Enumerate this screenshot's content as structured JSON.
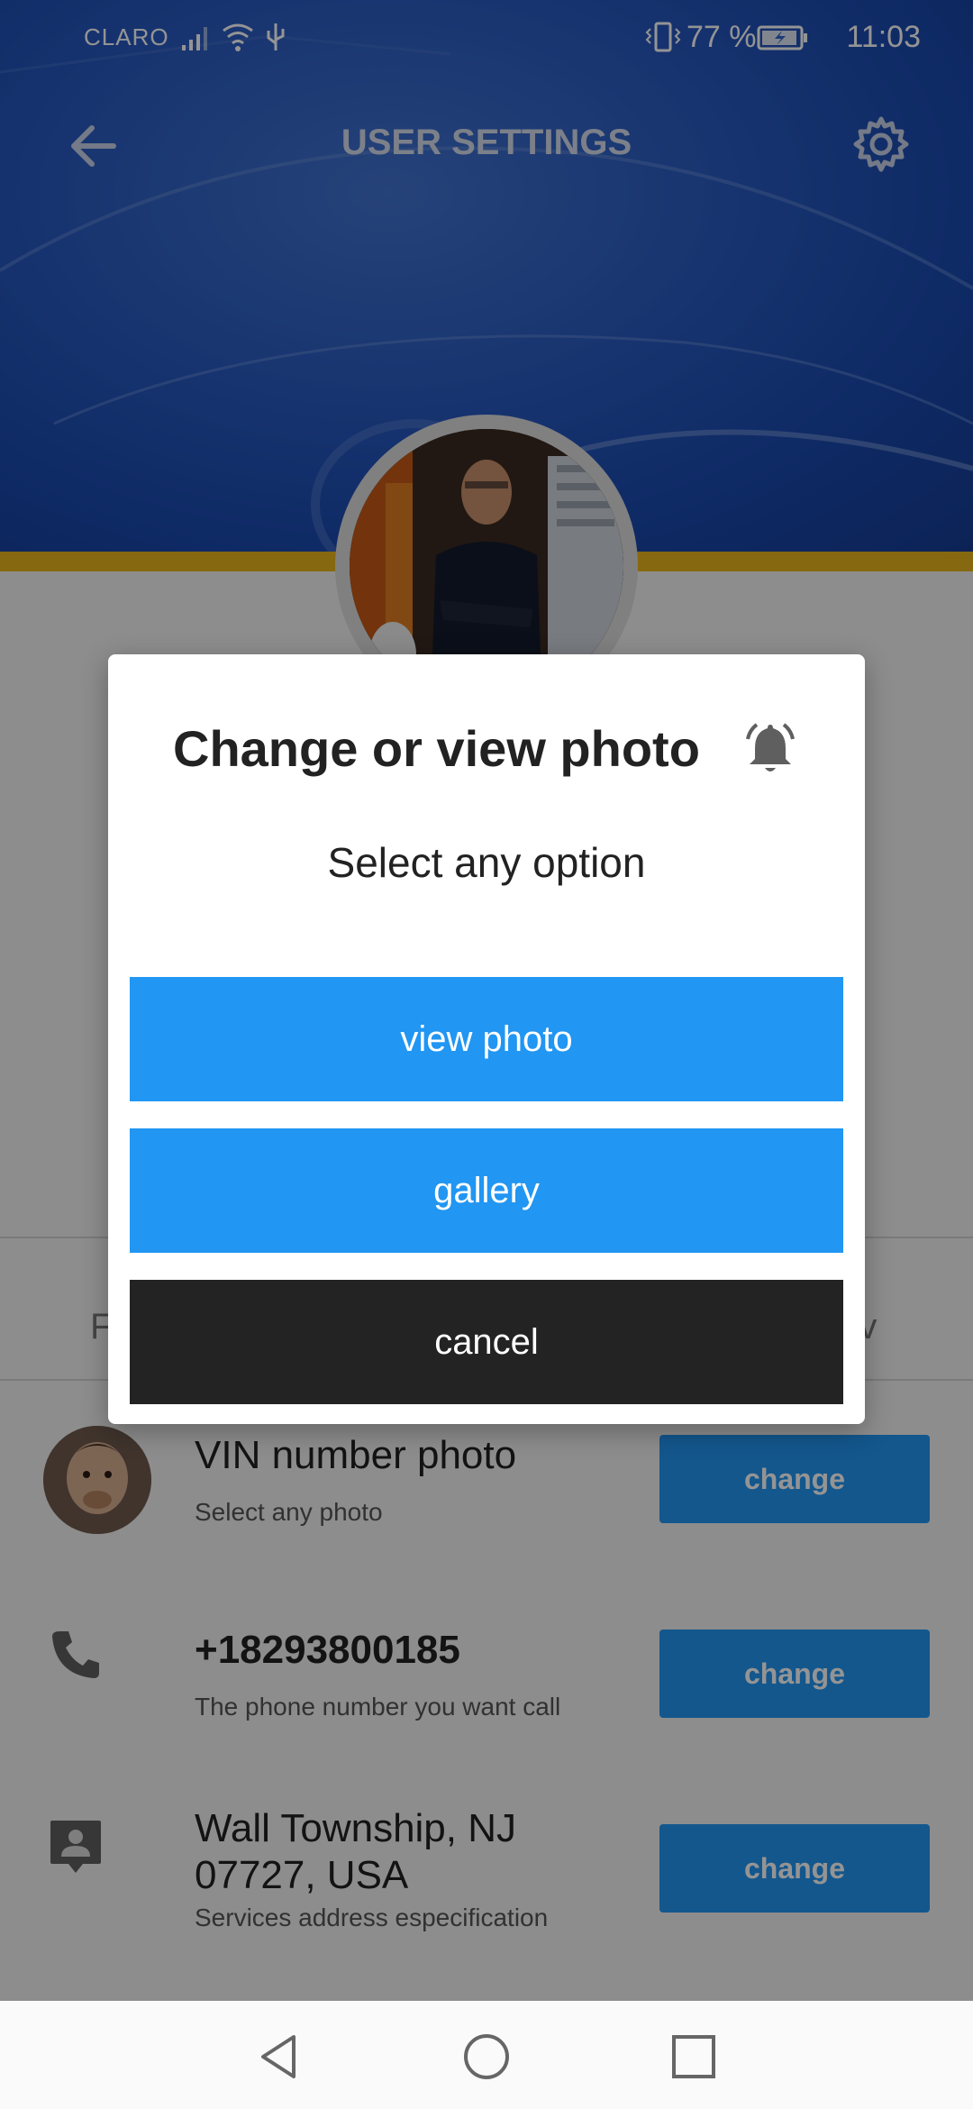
{
  "status_bar": {
    "carrier": "CLARO",
    "battery_percent": "77 %",
    "time": "11:03"
  },
  "header": {
    "title": "USER SETTINGS",
    "back_icon": "arrow-back-icon",
    "settings_icon": "gear-icon"
  },
  "tabs": {
    "left_partial": "F",
    "right_partial": "rv"
  },
  "rows": [
    {
      "title": "VIN number photo",
      "subtitle": "Select any photo",
      "button": "change"
    },
    {
      "title": "+18293800185",
      "subtitle": "The phone number you want call",
      "button": "change",
      "icon": "phone-icon"
    },
    {
      "title_line1": "Wall Township, NJ",
      "title_line2": "07727, USA",
      "subtitle": "Services address especification",
      "button": "change",
      "icon": "contact-card-icon"
    }
  ],
  "dialog": {
    "title": "Change or view photo",
    "subtitle": "Select any option",
    "icon": "bell-icon",
    "buttons": {
      "view_photo": "view photo",
      "gallery": "gallery",
      "cancel": "cancel"
    }
  },
  "colors": {
    "primary_blue": "#2196f3",
    "dark_button": "#232323",
    "gold_stripe": "#e7b41d",
    "header_blue": "#2f63cf"
  }
}
